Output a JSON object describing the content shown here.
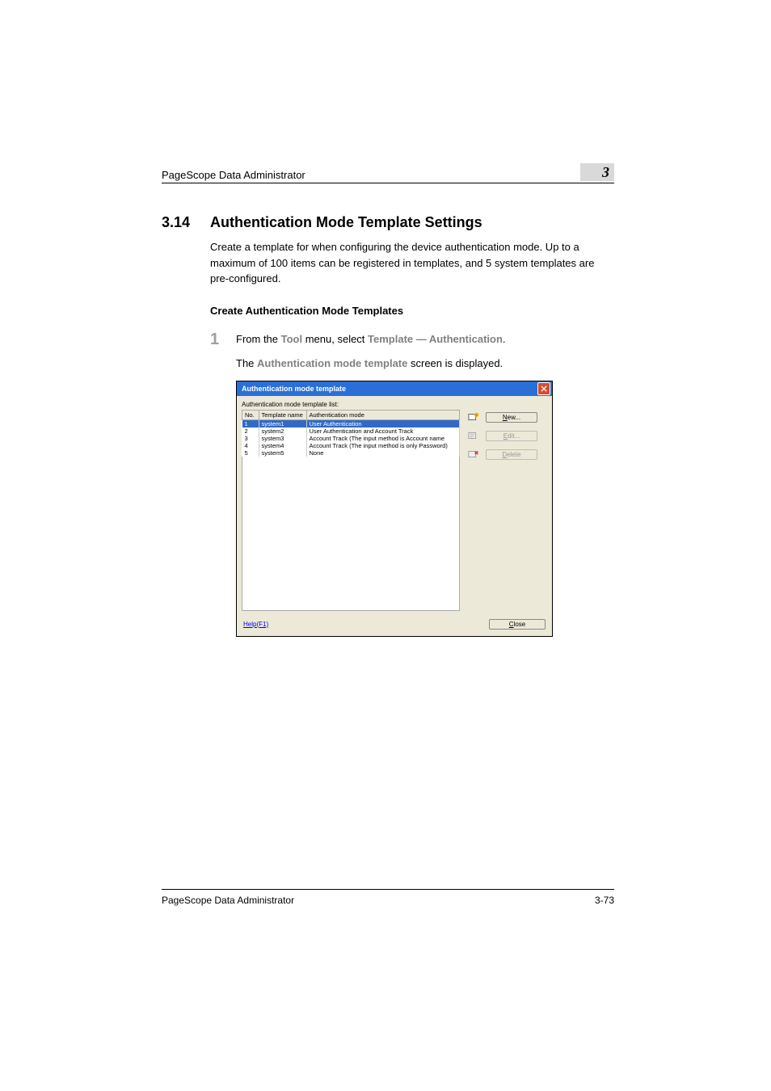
{
  "header": {
    "running_head": "PageScope Data Administrator",
    "chapter_number": "3"
  },
  "section": {
    "number": "3.14",
    "title": "Authentication Mode Template Settings",
    "intro": "Create a template for when configuring the device authentication mode. Up to a maximum of 100 items can be registered in templates, and 5 system templates are pre-configured."
  },
  "subsection": {
    "title": "Create Authentication Mode Templates"
  },
  "step1": {
    "number": "1",
    "text_prefix": "From the ",
    "menu": "Tool",
    "text_mid1": " menu, select ",
    "template": "Template",
    "sep": " — ",
    "auth": "Authentication",
    "text_suffix": ".",
    "sub_prefix": "The ",
    "screen_name": "Authentication mode template",
    "sub_suffix": " screen is displayed."
  },
  "dialog": {
    "title": "Authentication mode template",
    "list_label": "Authentication mode template list:",
    "columns": {
      "no": "No.",
      "name": "Template name",
      "mode": "Authentication mode"
    },
    "rows": [
      {
        "no": "1",
        "name": "system1",
        "mode": "User Authentication",
        "selected": true
      },
      {
        "no": "2",
        "name": "system2",
        "mode": "User Authentication and Account Track",
        "selected": false
      },
      {
        "no": "3",
        "name": "system3",
        "mode": "Account Track (The input method is Account name",
        "selected": false
      },
      {
        "no": "4",
        "name": "system4",
        "mode": "Account Track (The input method is only Password)",
        "selected": false
      },
      {
        "no": "5",
        "name": "system5",
        "mode": "None",
        "selected": false
      }
    ],
    "buttons": {
      "new": "New...",
      "edit": "Edit...",
      "delete": "Delete"
    },
    "help": "Help(F1)",
    "close": "Close"
  },
  "footer": {
    "left": "PageScope Data Administrator",
    "right": "3-73"
  }
}
